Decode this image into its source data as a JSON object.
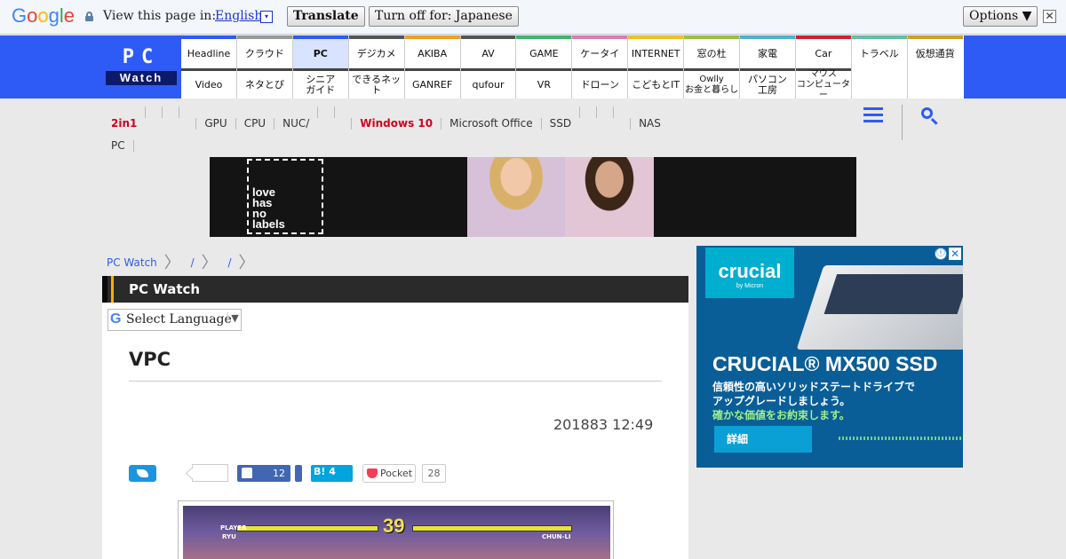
{
  "translate_bar": {
    "logo": "Google",
    "view_label": "View this page in:",
    "language": "English",
    "language_dropdown": "▾",
    "translate_button": "Translate",
    "turn_off_button": "Turn off for: Japanese",
    "options_button": "Options ▼",
    "close": "✕"
  },
  "logo": {
    "top": "PC",
    "bottom": "Watch"
  },
  "nav_row1": [
    "Headline",
    "クラウド",
    "PC",
    "デジカメ",
    "AKIBA",
    "AV",
    "GAME",
    "ケータイ",
    "INTERNET",
    "窓の杜",
    "家電",
    "Car",
    "トラベル",
    "仮想通貨"
  ],
  "nav_row1_colors": [
    "#2e5bf5",
    "#999999",
    "#2e5bf5",
    "#555555",
    "#f0a020",
    "#555555",
    "#3fb56b",
    "#e07ab0",
    "#f0c020",
    "#9ac040",
    "#50b0d0",
    "#d02030",
    "#60c0a0",
    "#d0a020"
  ],
  "nav_row2": [
    "Video",
    "ネタとぴ",
    "シニア\nガイド",
    "できるネット",
    "GANREF",
    "qufour",
    "VR",
    "ドローン",
    "こどもとIT",
    "Owlly\nお金と暮らし",
    "パソコン\n工房",
    "マウス\nコンピューター"
  ],
  "topics": {
    "items": [
      "2in1",
      "",
      "",
      "",
      "GPU",
      "CPU",
      "NUC/",
      "",
      "",
      "Windows 10",
      "Microsoft Office",
      "SSD",
      "",
      "",
      "",
      "NAS",
      "PC"
    ],
    "highlight": [
      "2in1",
      "Windows 10"
    ]
  },
  "banner": {
    "text": "love\nhas\nno\nlabels"
  },
  "breadcrumb": [
    "PC Watch",
    "/",
    "",
    "/",
    ""
  ],
  "article": {
    "section": "PC Watch",
    "select_language": "Select Language",
    "select_arrow": "▼",
    "title": "VPC",
    "date": "201883 12:49",
    "facebook_count": "12",
    "hatena_label": "B!",
    "hatena_count": "4",
    "pocket_label": "Pocket",
    "pocket_count": "28",
    "game": {
      "timer": "39",
      "player_tag": "PLAYER",
      "p1": "RYU",
      "p2": "CHUN-LI"
    }
  },
  "right_ad": {
    "brand": "crucial",
    "brand_sub": "by Micron",
    "headline": "CRUCIAL® MX500 SSD",
    "line1": "信頼性の高いソリッドステートドライブで",
    "line2": "アップグレードしましょう。",
    "line3": "確かな価値をお約束します。",
    "button": "詳細",
    "info": "ⓘ",
    "close": "✕"
  }
}
